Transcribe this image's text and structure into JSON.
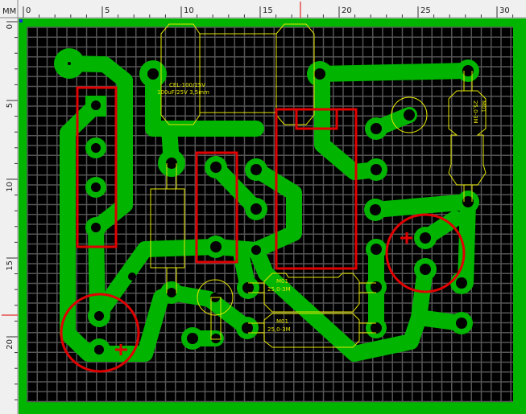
{
  "ruler": {
    "unit": "MM",
    "x_labels": [
      "0",
      "5",
      "10",
      "15",
      "20",
      "25",
      "30"
    ],
    "y_labels": [
      "0",
      "5",
      "10",
      "15",
      "20"
    ],
    "cursor_x_mm": 17.3,
    "cursor_y_mm": 18.6
  },
  "colors": {
    "copper": "#00b400",
    "background": "#000000",
    "grid": "#555555",
    "silkscreen": "#e6e600",
    "highlight": "#e00000"
  },
  "silkscreen_labels": {
    "c1_value": "CEL-100/25V",
    "c1_type": "100uF/25V 3,5mm",
    "r1_name": "M01",
    "r1_value": "25,0-3M",
    "r2_name": "M01",
    "r2_value": "25,0-3M",
    "r3_name": "M01",
    "r3_value": "25,0-3M"
  }
}
